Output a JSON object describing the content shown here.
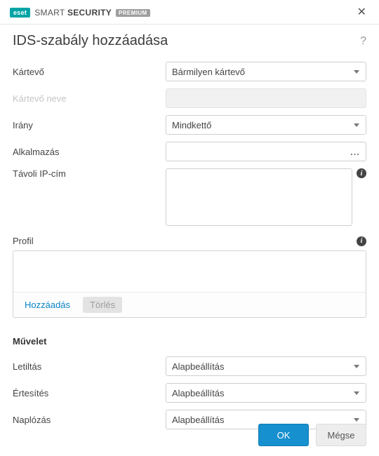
{
  "brand": {
    "logo": "eset",
    "text_light": "SMART",
    "text_bold": "SECURITY",
    "badge": "PREMIUM"
  },
  "title": "IDS-szabály hozzáadása",
  "labels": {
    "kartevo": "Kártevő",
    "kartevo_neve": "Kártevő neve",
    "irany": "Irány",
    "alkalmazas": "Alkalmazás",
    "tavoli_ip": "Távoli IP-cím",
    "profil": "Profil",
    "muvelet": "Művelet",
    "letiltas": "Letiltás",
    "ertesites": "Értesítés",
    "naplozas": "Naplózás"
  },
  "values": {
    "kartevo": "Bármilyen kártevő",
    "irany": "Mindkettő",
    "letiltas": "Alapbeállítás",
    "ertesites": "Alapbeállítás",
    "naplozas": "Alapbeállítás"
  },
  "buttons": {
    "hozzaadas": "Hozzáadás",
    "torles": "Törlés",
    "ok": "OK",
    "megse": "Mégse"
  }
}
